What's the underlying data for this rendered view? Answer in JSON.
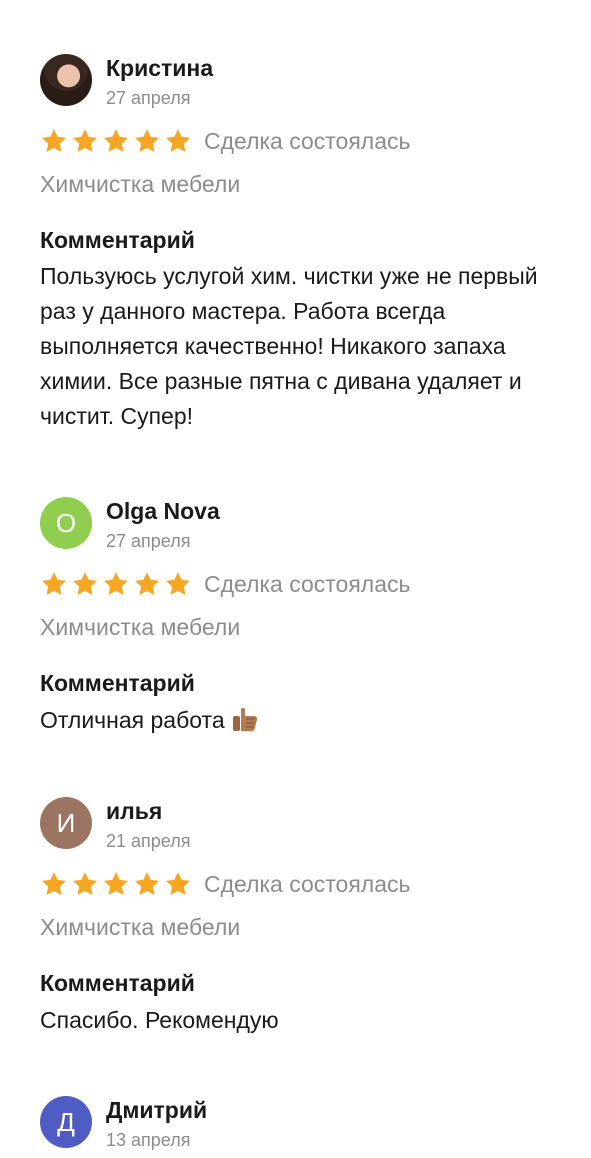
{
  "reviews": [
    {
      "author": "Кристина",
      "avatar_letter": "",
      "avatar_icon": "user-photo",
      "date": "27 апреля",
      "rating": 5,
      "deal_status": "Сделка состоялась",
      "service": "Химчистка мебели",
      "comment_label": "Комментарий",
      "comment": "Пользуюсь услугой хим. чистки уже не первый раз у данного мастера. Работа всегда выполняется качественно! Никакого запаха химии. Все разные пятна с дивана удаляет и чистит. Супер!"
    },
    {
      "author": "Olga Nova",
      "avatar_letter": "O",
      "avatar_color": "#8fce4e",
      "date": "27 апреля",
      "rating": 5,
      "deal_status": "Сделка состоялась",
      "service": "Химчистка мебели",
      "comment_label": "Комментарий",
      "comment": "Отличная работа",
      "comment_emoji": "thumbs-up-icon"
    },
    {
      "author": "илья",
      "avatar_letter": "И",
      "avatar_color": "#9b7562",
      "date": "21 апреля",
      "rating": 5,
      "deal_status": "Сделка состоялась",
      "service": "Химчистка мебели",
      "comment_label": "Комментарий",
      "comment": "Спасибо. Рекомендую"
    },
    {
      "author": "Дмитрий",
      "avatar_letter": "Д",
      "avatar_color": "#4f5cc4",
      "date": "13 апреля"
    }
  ],
  "colors": {
    "star": "#f6a623",
    "secondary_text": "#8c8c8c",
    "primary_text": "#1a1a1a"
  }
}
